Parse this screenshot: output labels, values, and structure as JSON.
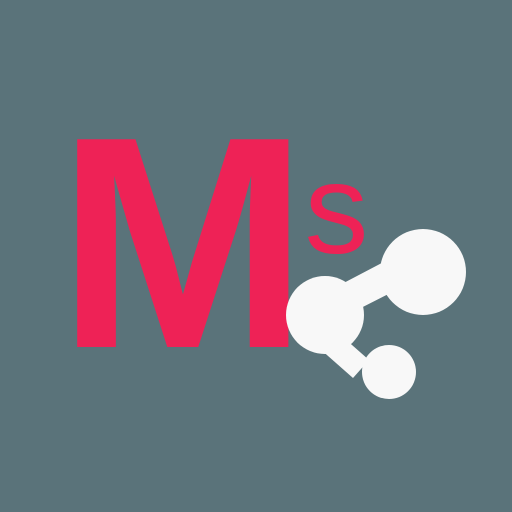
{
  "logo": {
    "letter_main": "M",
    "letter_superscript": "s",
    "colors": {
      "background": "#5a737a",
      "accent": "#ee2256",
      "icon": "#f8f8f8"
    },
    "icon": "share-network-icon"
  }
}
